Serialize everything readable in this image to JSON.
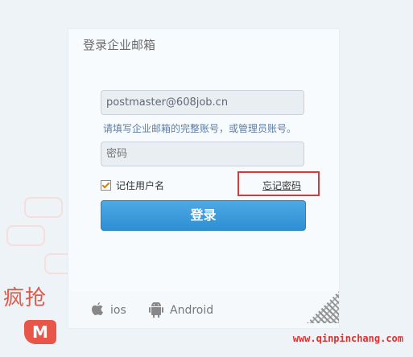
{
  "panel": {
    "title": "登录企业邮箱",
    "email_value": "postmaster@608job.cn",
    "email_hint": "请填写企业邮箱的完整账号，或管理员账号。",
    "password_placeholder": "密码",
    "remember_label": "记住用户名",
    "remember_checked": true,
    "forgot_label": "忘记密码",
    "login_label": "登录"
  },
  "footer": {
    "ios_label": "ios",
    "android_label": "Android"
  },
  "promo": {
    "text": "疯抢"
  },
  "watermark": "www.qinpinchang.com",
  "colors": {
    "accent": "#2f8fd3",
    "highlight": "#d63b3b",
    "promo": "#e05a4a"
  }
}
